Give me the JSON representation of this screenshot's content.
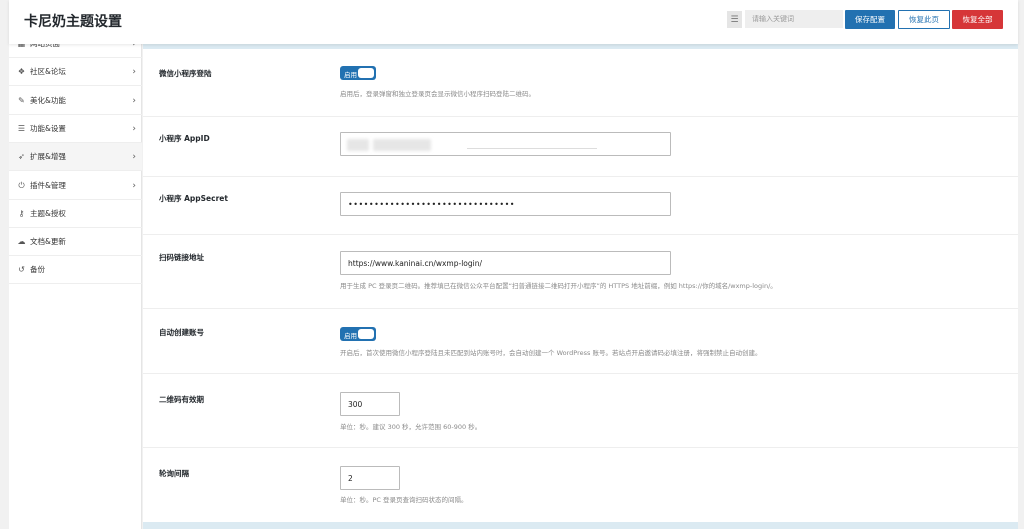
{
  "header": {
    "title": "卡尼奶主题设置",
    "search_placeholder": "请输入关键词",
    "search_toggle_icon": "list-icon",
    "save_label": "保存配置",
    "reset_page_label": "恢复此页",
    "reset_all_label": "恢复全部"
  },
  "sidebar": {
    "items": [
      {
        "label": "网站页面",
        "icon": "grid-icon",
        "chevron": true
      },
      {
        "label": "社区&论坛",
        "icon": "users-icon",
        "chevron": true
      },
      {
        "label": "美化&功能",
        "icon": "magic-icon",
        "chevron": true
      },
      {
        "label": "功能&设置",
        "icon": "sliders-icon",
        "chevron": true
      },
      {
        "label": "扩展&增强",
        "icon": "rocket-icon",
        "chevron": true
      },
      {
        "label": "插件&管理",
        "icon": "plug-icon",
        "chevron": true
      },
      {
        "label": "主题&授权",
        "icon": "key-icon",
        "chevron": false
      },
      {
        "label": "文档&更新",
        "icon": "cloud-icon",
        "chevron": false
      },
      {
        "label": "备份",
        "icon": "history-icon",
        "chevron": false
      }
    ]
  },
  "fields": {
    "miniprogram_login": {
      "label": "微信小程序登陆",
      "toggle_label": "启用",
      "desc": "启用后，登录弹窗和独立登录页会显示微信小程序扫码登陆二维码。"
    },
    "appid": {
      "label": "小程序 AppID",
      "value": ""
    },
    "appsecret": {
      "label": "小程序 AppSecret",
      "value": "••••••••••••••••••••••••••••••••"
    },
    "scan_url": {
      "label": "扫码链接地址",
      "value": "https://www.kaninai.cn/wxmp-login/",
      "desc": "用于生成 PC 登录页二维码。推荐填已在微信公众平台配置“扫普通链接二维码打开小程序”的 HTTPS 地址前缀，例如 https://你的域名/wxmp-login/。"
    },
    "auto_create": {
      "label": "自动创建账号",
      "toggle_label": "启用",
      "desc": "开启后，首次使用微信小程序登陆且未匹配到站内账号时，会自动创建一个 WordPress 账号。若站点开启邀请码必填注册，将强制禁止自动创建。"
    },
    "qr_expire": {
      "label": "二维码有效期",
      "value": "300",
      "desc": "单位：秒。建议 300 秒，允许范围 60-900 秒。"
    },
    "poll_interval": {
      "label": "轮询间隔",
      "value": "2",
      "desc": "单位：秒。PC 登录页查询扫码状态的间隔。"
    }
  },
  "colors": {
    "primary": "#2271b1",
    "danger": "#d63638",
    "band": "#dbeaf2"
  }
}
